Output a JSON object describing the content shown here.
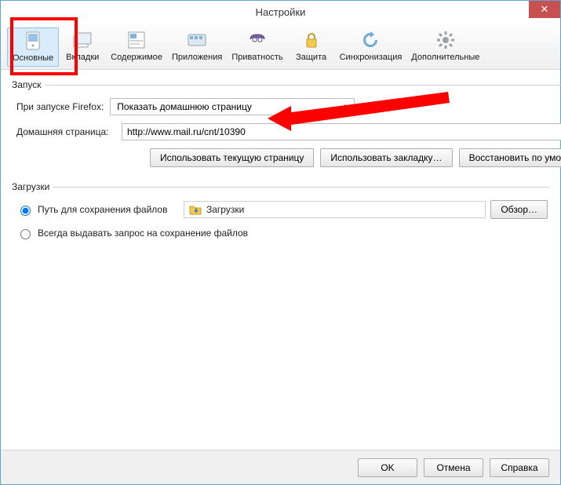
{
  "window": {
    "title": "Настройки"
  },
  "tabs": {
    "general": "Основные",
    "tabs": "Вкладки",
    "content": "Содержимое",
    "applications": "Приложения",
    "privacy": "Приватность",
    "security": "Защита",
    "sync": "Синхронизация",
    "advanced": "Дополнительные"
  },
  "startup": {
    "legend": "Запуск",
    "when_starts_label": "При запуске Firefox:",
    "when_starts_value": "Показать домашнюю страницу",
    "homepage_label": "Домашняя страница:",
    "homepage_value": "http://www.mail.ru/cnt/10390",
    "use_current": "Использовать текущую страницу",
    "use_bookmark": "Использовать закладку…",
    "restore_default": "Восстановить по умолчанию"
  },
  "downloads": {
    "legend": "Загрузки",
    "save_to_label": "Путь для сохранения файлов",
    "folder_name": "Загрузки",
    "browse": "Обзор…",
    "always_ask": "Всегда выдавать запрос на сохранение файлов"
  },
  "footer": {
    "ok": "OK",
    "cancel": "Отмена",
    "help": "Справка"
  }
}
